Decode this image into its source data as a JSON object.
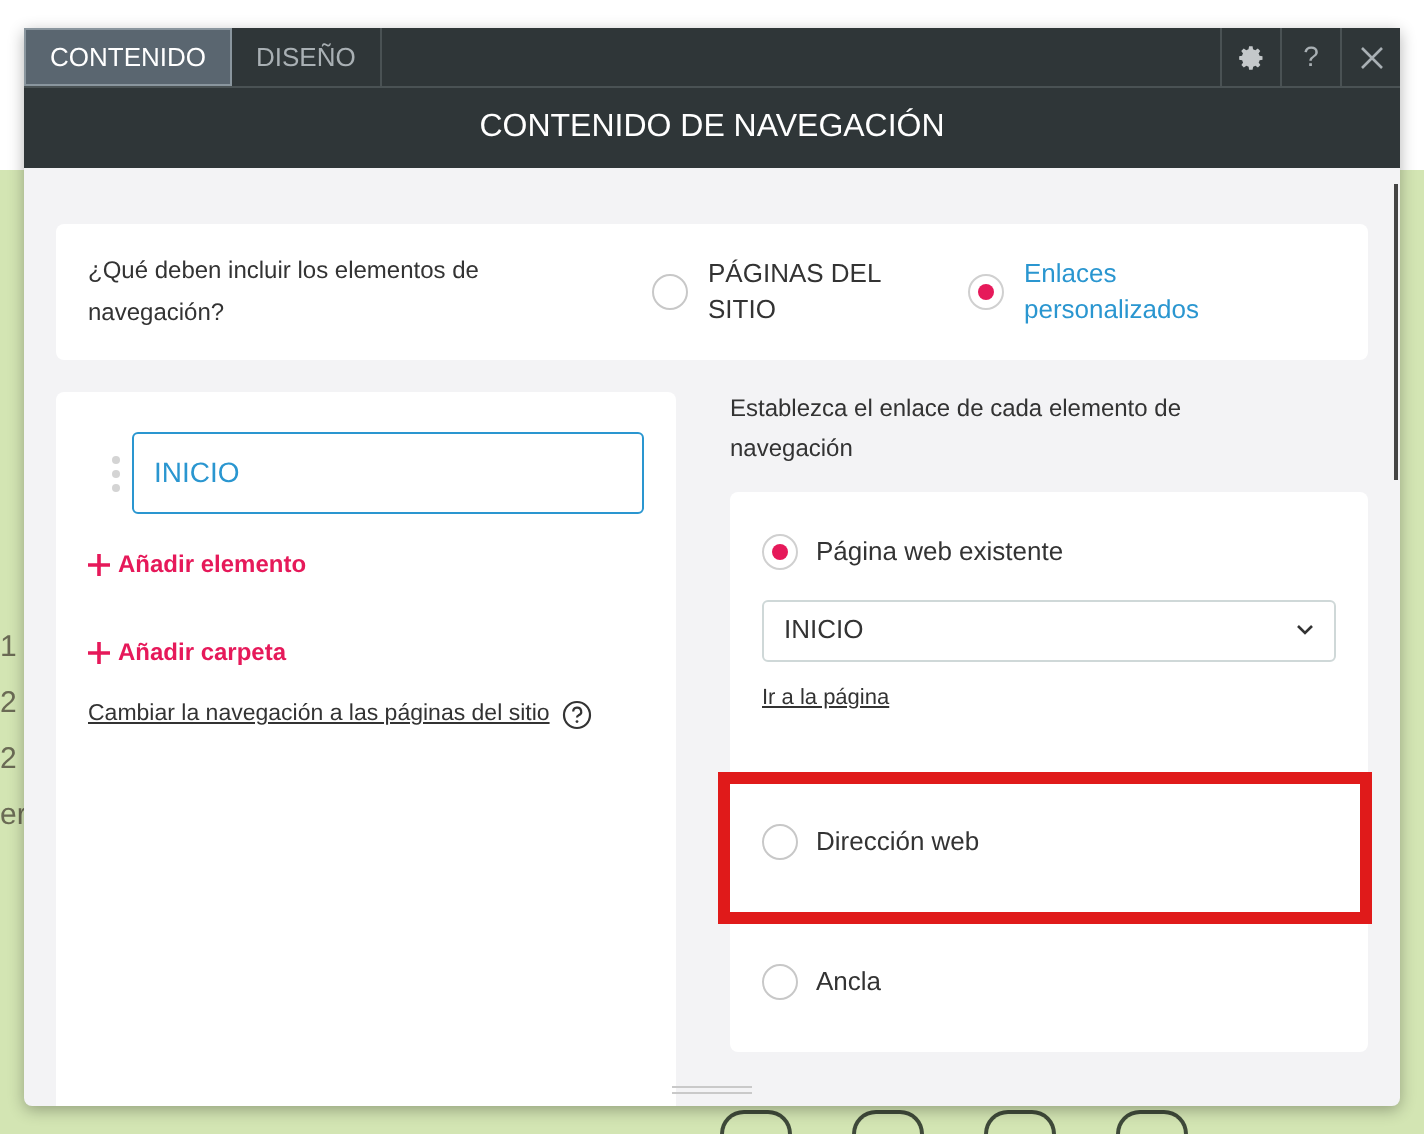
{
  "background": {
    "fragments": [
      "1",
      "2",
      "2",
      "er"
    ]
  },
  "dialog": {
    "tabs": [
      {
        "label": "CONTENIDO",
        "selected": true
      },
      {
        "label": "DISEÑO",
        "selected": false
      }
    ],
    "toolbar": {
      "help": "?"
    },
    "title": "CONTENIDO DE NAVEGACIÓN",
    "question": {
      "text": "¿Qué deben incluir los elementos de navegación?",
      "options": [
        {
          "label": "PÁGINAS DEL SITIO",
          "selected": false
        },
        {
          "label": "Enlaces personalizados",
          "selected": true
        }
      ]
    },
    "items": [
      {
        "label": "INICIO"
      }
    ],
    "actions": [
      "Añadir elemento",
      "Añadir carpeta"
    ],
    "switch_link": "Cambiar la navegación a las páginas del sitio",
    "link_panel": {
      "intro": "Establezca el enlace de cada elemento de navegación",
      "options": [
        {
          "label": "Página web existente",
          "selected": true,
          "highlighted": false,
          "select_value": "INICIO",
          "link": "Ir a la página"
        },
        {
          "label": "Dirección web",
          "selected": false,
          "highlighted": true
        },
        {
          "label": "Ancla",
          "selected": false,
          "highlighted": false
        }
      ]
    }
  }
}
